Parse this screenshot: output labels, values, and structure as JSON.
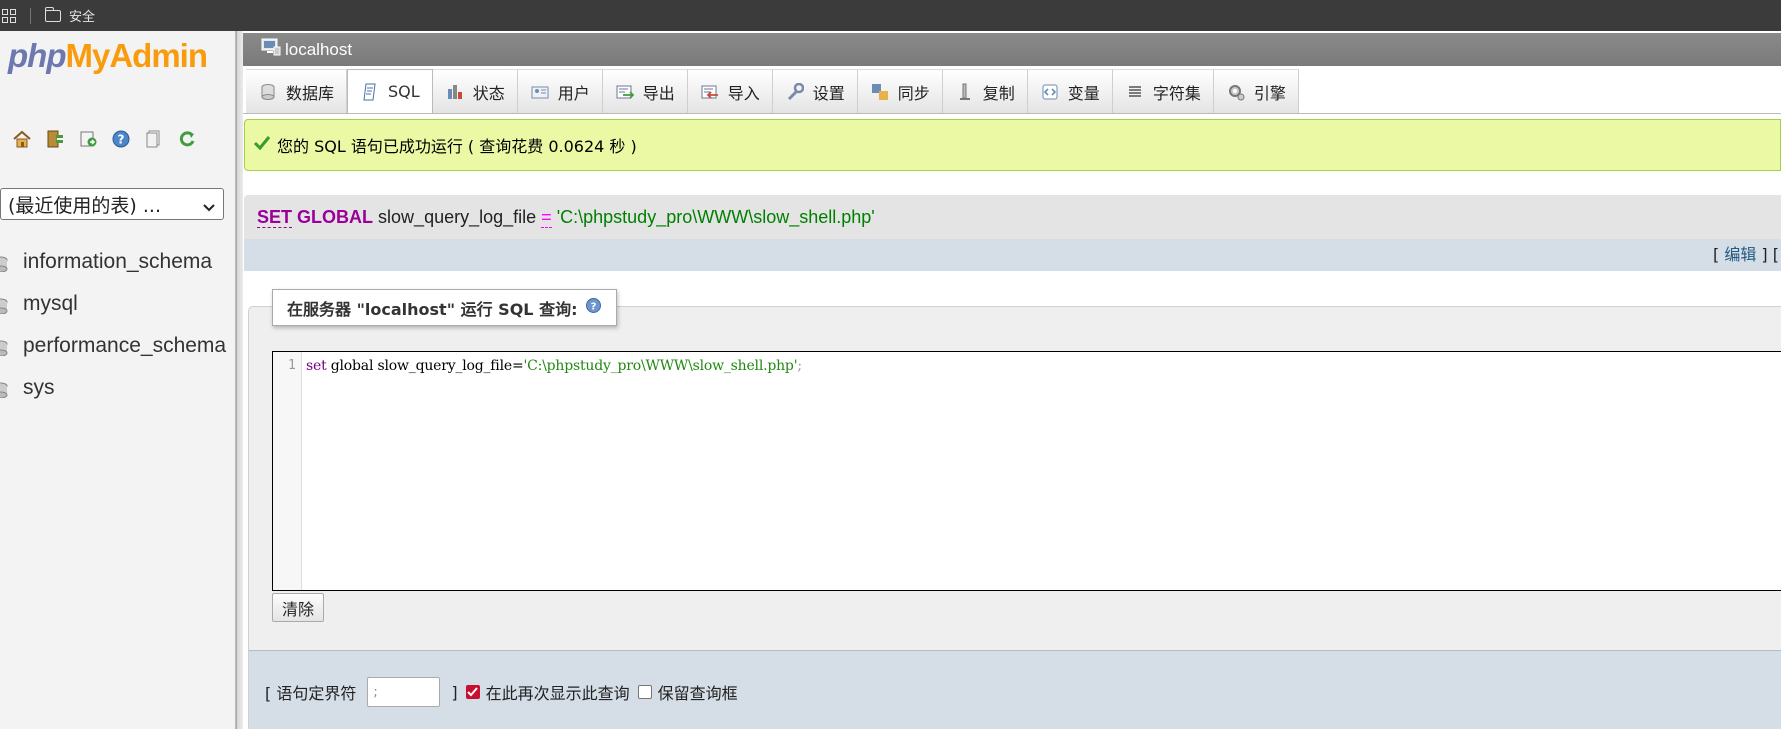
{
  "browser": {
    "security_label": "安全"
  },
  "nav": {
    "logo": {
      "php": "php",
      "my": "My",
      "admin": "Admin"
    },
    "icons": [
      "home-icon",
      "logout-icon",
      "query-window-icon",
      "help-icon",
      "docs-icon",
      "reload-icon"
    ],
    "recent_tables": "(最近使用的表) ...",
    "databases": [
      "information_schema",
      "mysql",
      "performance_schema",
      "sys"
    ]
  },
  "server": {
    "name": "localhost"
  },
  "tabs": [
    {
      "label": "数据库",
      "icon": "database-icon"
    },
    {
      "label": "SQL",
      "icon": "sql-icon",
      "active": true
    },
    {
      "label": "状态",
      "icon": "status-icon"
    },
    {
      "label": "用户",
      "icon": "users-icon"
    },
    {
      "label": "导出",
      "icon": "export-icon"
    },
    {
      "label": "导入",
      "icon": "import-icon"
    },
    {
      "label": "设置",
      "icon": "settings-icon"
    },
    {
      "label": "同步",
      "icon": "sync-icon"
    },
    {
      "label": "复制",
      "icon": "replication-icon"
    },
    {
      "label": "变量",
      "icon": "variables-icon"
    },
    {
      "label": "字符集",
      "icon": "charset-icon"
    },
    {
      "label": "引擎",
      "icon": "engine-icon"
    }
  ],
  "success": {
    "message": "您的 SQL 语句已成功运行 ( 查询花费 0.0624 秒 )"
  },
  "sql_echo": {
    "set": "SET",
    "global": "GLOBAL",
    "variable": "slow_query_log_file",
    "operator": "=",
    "value": "'C:\\phpstudy_pro\\WWW\\slow_shell.php'",
    "links_prefix": "[",
    "edit_link": "编辑",
    "links_suffix": "] ["
  },
  "query_box": {
    "legend": "在服务器 \"localhost\" 运行 SQL 查询:",
    "line_number": "1",
    "code_kw1": "set",
    "code_kw2": "global",
    "code_var": "slow_query_log_file",
    "code_eq": "=",
    "code_str": "'C:\\phpstudy_pro\\WWW\\slow_shell.php'",
    "code_end": ";",
    "clear_button": "清除"
  },
  "footer": {
    "delimiter_label": "[ 语句定界符",
    "delimiter_value": ";",
    "delimiter_close": "]",
    "show_query_again": {
      "label": "在此再次显示此查询",
      "checked": true
    },
    "retain_query_box": {
      "label": "保留查询框",
      "checked": false
    }
  }
}
